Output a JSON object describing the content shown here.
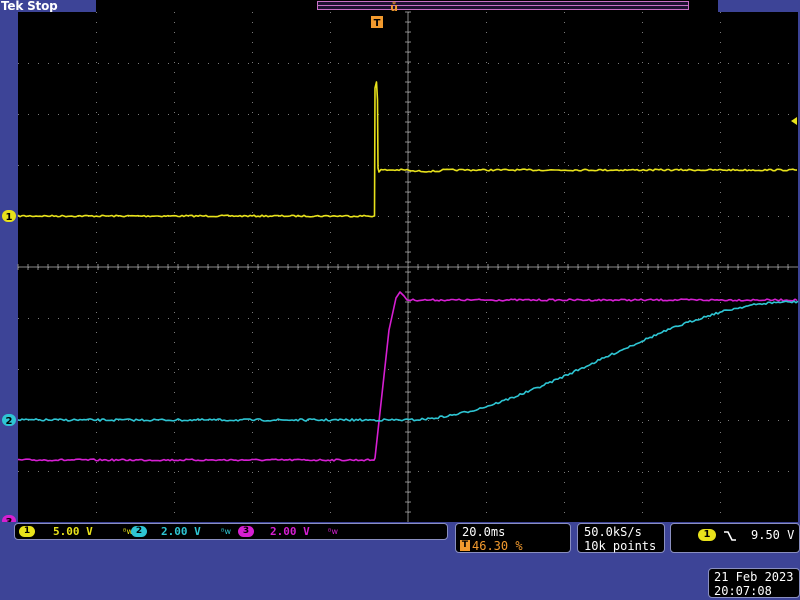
{
  "header": {
    "title": "Tek Stop"
  },
  "colors": {
    "background": "#3d4497",
    "graticule_bg": "#000000",
    "ch1": "#e8e21b",
    "ch2": "#2ec5d3",
    "ch3": "#d61fd2",
    "accent_orange": "#f29a2e"
  },
  "markers": {
    "ch1": "1",
    "ch2": "2",
    "ch3": "3",
    "trigger_pos_icon": "T",
    "expansion_icon": "ů",
    "trigger_level_icon": "arrow-left"
  },
  "channels": [
    {
      "id": "1",
      "scale": "5.00 V",
      "bw_icon": "bandwidth-limit-icon"
    },
    {
      "id": "2",
      "scale": "2.00 V",
      "bw_icon": "bandwidth-limit-icon"
    },
    {
      "id": "3",
      "scale": "2.00 V",
      "bw_icon": "bandwidth-limit-icon"
    }
  ],
  "timebase": {
    "scale": "20.0ms",
    "trigger_position": "46.30 %"
  },
  "acquisition": {
    "sample_rate": "50.0kS/s",
    "record_length": "10k points"
  },
  "trigger": {
    "source": "1",
    "slope_icon": "falling-edge-icon",
    "level": "9.50 V"
  },
  "datetime": {
    "date": "21 Feb  2023",
    "time": "20:07:08"
  }
}
